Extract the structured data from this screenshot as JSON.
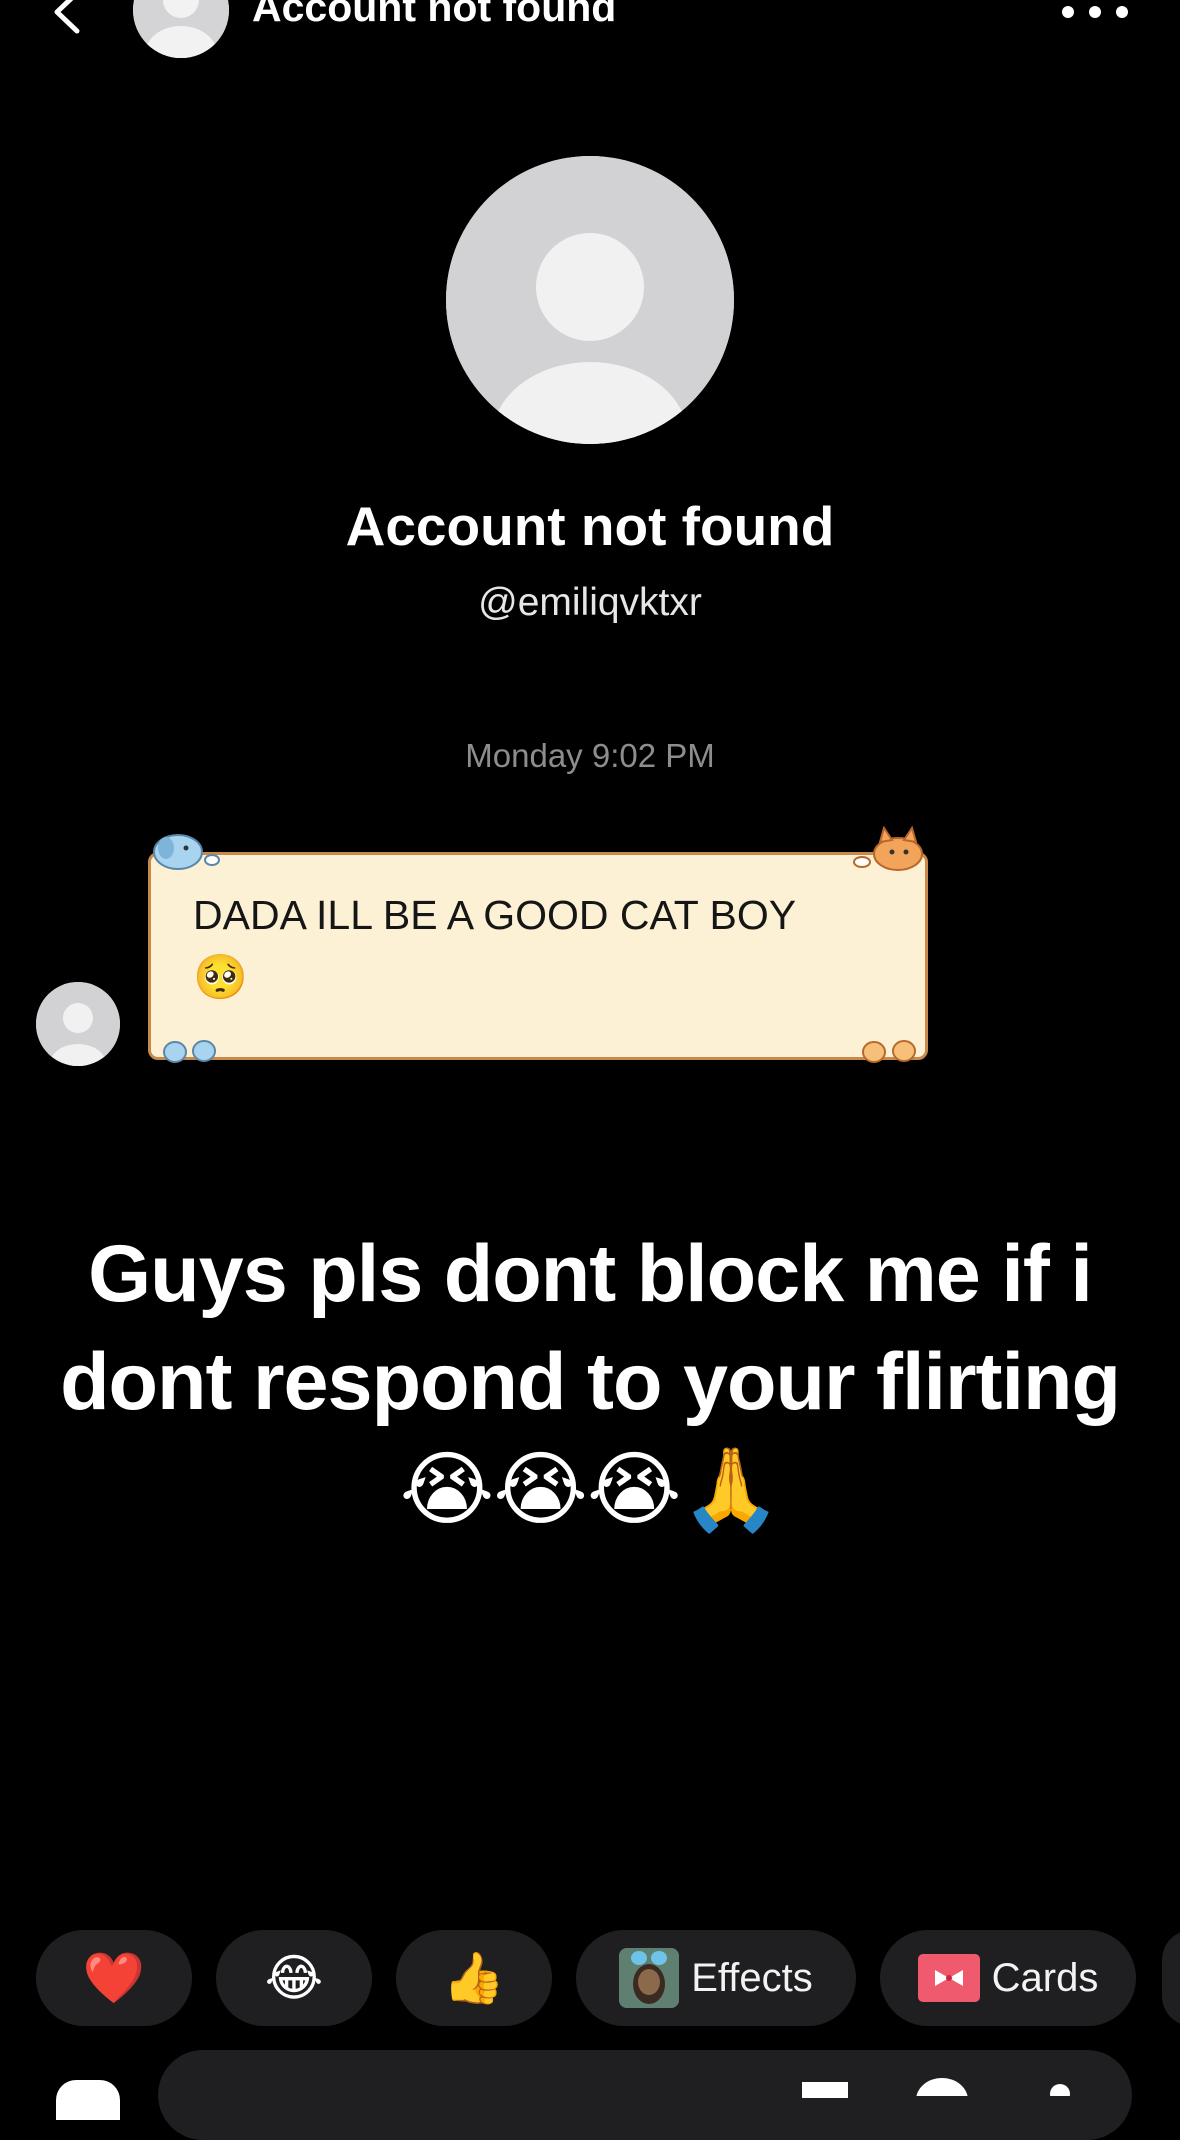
{
  "header": {
    "title": "Account not found"
  },
  "profile": {
    "name": "Account not found",
    "handle": "@emiliqvktxr"
  },
  "conversation": {
    "timestamp": "Monday 9:02 PM",
    "messages": [
      {
        "text": "DADA ILL BE A GOOD CAT BOY",
        "emoji": "🥺"
      }
    ]
  },
  "overlay": {
    "caption": "Guys pls dont block me if i dont respond to your flirting😭😭😭🙏"
  },
  "quick_reactions": {
    "heart": "❤️",
    "laugh": "😂",
    "thumbs_up": "👍",
    "effects_label": "Effects",
    "cards_label": "Cards"
  },
  "colors": {
    "background": "#000000",
    "pill": "#1f1f21",
    "bubble_fill": "#fcf1d4",
    "bubble_border": "#c88a4a",
    "timestamp": "#8d8d8f",
    "cards_icon": "#f05a6e"
  },
  "icons": {
    "back": "chevron-left-icon",
    "more": "more-horizontal-icon",
    "avatar": "default-avatar-icon"
  }
}
